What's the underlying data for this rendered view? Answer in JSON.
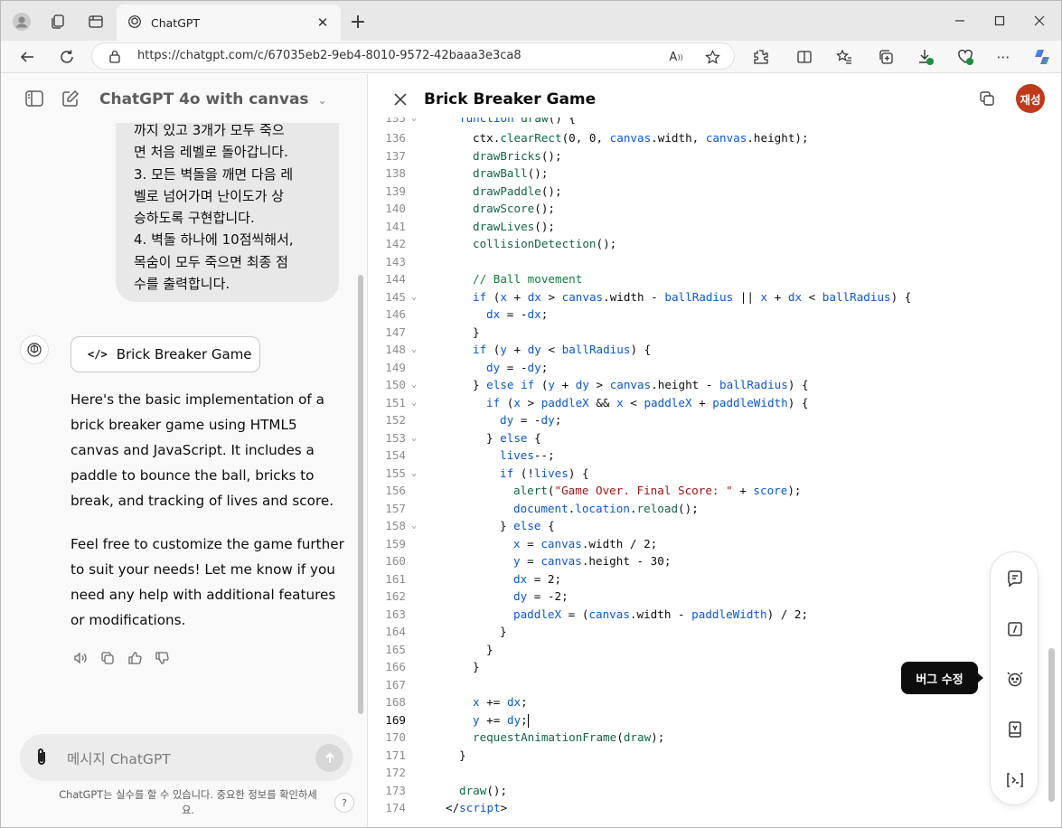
{
  "browser": {
    "tab_title": "ChatGPT",
    "url": "https://chatgpt.com/c/67035eb2-9eb4-8010-9572-42baaa3e3ca8"
  },
  "chat": {
    "model_name": "ChatGPT 4o with canvas",
    "user_message": "까지 있고 3개가 모두 죽으\n면 처음 레벨로 돌아갑니다.\n3. 모든 벽돌을 깨면 다음 레\n벨로 넘어가며 난이도가 상\n승하도록 구현합니다.\n4. 벽돌 하나에 10점씩해서,\n목숨이 모두 죽으면 최종 점\n수를 출력합니다.",
    "canvas_button_label": "Brick Breaker Game",
    "reply_paragraph_1": "Here's the basic implementation of a brick breaker game using HTML5 canvas and JavaScript. It includes a paddle to bounce the ball, bricks to break, and tracking of lives and score.",
    "reply_paragraph_2": "Feel free to customize the game further to suit your needs! Let me know if you need any help with additional features or modifications.",
    "composer_placeholder": "메시지 ChatGPT",
    "disclaimer": "ChatGPT는 실수를 할 수 있습니다. 중요한 정보를 확인하세요.",
    "help_label": "?"
  },
  "canvas": {
    "title": "Brick Breaker Game",
    "user_initials": "재성",
    "tooltip": "버그 수정",
    "active_line": 169,
    "first_line_partial": "function draw() {"
  },
  "colors": {
    "keyword": "#0b57d0",
    "user_avatar": "#c0391b",
    "tooltip_bg": "#0d0d0d"
  }
}
